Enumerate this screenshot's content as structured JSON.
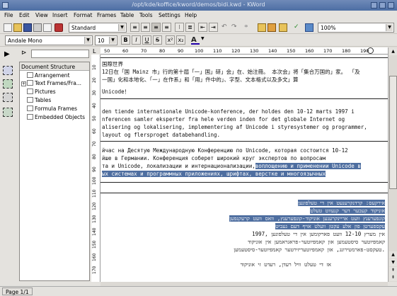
{
  "window": {
    "title": "/opt/kde/koffice/kword/demos/bidi.kwd - KWord"
  },
  "menu": [
    "File",
    "Edit",
    "View",
    "Insert",
    "Format",
    "Frames",
    "Table",
    "Tools",
    "Settings",
    "Help"
  ],
  "toolbar": {
    "style_select": "Standard",
    "zoom_select": "100%"
  },
  "format_bar": {
    "font_select": "Andale Mono",
    "size_select": "10",
    "bold": "B",
    "italic": "I",
    "underline": "U",
    "strike": "S"
  },
  "sidebar": {
    "header": "Document Structure",
    "items": [
      {
        "label": "Arrangement",
        "expandable": false
      },
      {
        "label": "Text Frames/Fra...",
        "expandable": true
      },
      {
        "label": "Pictures",
        "expandable": false
      },
      {
        "label": "Tables",
        "expandable": false
      },
      {
        "label": "Formula Frames",
        "expandable": false
      },
      {
        "label": "Embedded Objects",
        "expandable": false
      }
    ]
  },
  "ruler": {
    "h_ticks": [
      "50",
      "60",
      "70",
      "80",
      "90",
      "100",
      "110",
      "120",
      "130",
      "140",
      "150",
      "160",
      "170",
      "180",
      "190"
    ],
    "v_ticks": [
      "10",
      "20",
      "30",
      "40",
      "50",
      "60",
      "70",
      "80",
      "90",
      "100",
      "110",
      "120",
      "130",
      "140",
      "150",
      "160",
      "170",
      "180"
    ]
  },
  "document": {
    "lines": [
      "国際世界",
      "12日在「国 Mainz 市」行的第十屆「一」国」研」会」在、始注冊。 本次会」将「集合万国的」家。 「及",
      "一国」化和本地化、「一」在作系」和「用」件中的」、字型、文本格式以及多文」算",
      "Unicode！",
      "den tiende internationale Unicode-konference, der holdes den 10-12 marts 1997 i",
      "nferencen samler eksperter fra hele verden inden for det globale Internet og",
      "alisering og lokalisering, implementering af Unicode i styresystemer og programmer,",
      "layout og flersproget databehandling.",
      "йчас на Десятую Международную Конференцию по Unicode, которая состоится 10-12",
      "йше в Германии. Конференция соберет широкий круг экспертов по  вопросам",
      "та и Unicode, локализации и интернационализации,",
      "воплощению и применении Unicode в",
      "ых системах и программных приложениях, шрифтах, верстке и многоязычных"
    ],
    "rtl_lines": [
      "אירקעס: קרדנקרענעט אין די טעלפונען",
      "אוניקוד קעבער דער קנעווט טעלט",
      "קונפערענץ וועט אריינקרענען אוניקוד-קונפערענץ, וואס וועט קרעקנפען",
      "עקספערטן פון אלע עקטן וועלט אויף דעם געביט",
      "1997, אין מערץ 12-10 וועט פארקומען אין די טעלפונען",
      "קאמפיוטער סיסטעמען און קאמפיוטער-פראגראמען אין אוניקוד",
      "טעקסט-פארמטירונג, און קאמפיוטעריזירטער קאמפיוטער-סיסטעמען.",
      "אז די טעלט וויל רעדן, רעדט זי אוניקוד"
    ]
  },
  "status": {
    "page": "Page 1/1"
  }
}
